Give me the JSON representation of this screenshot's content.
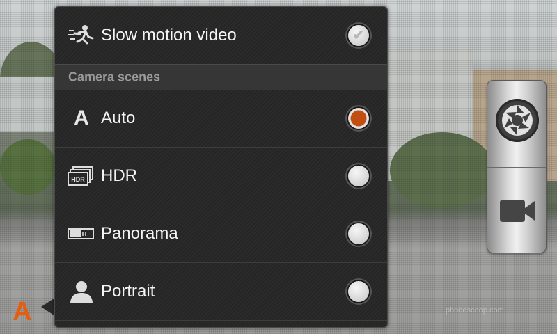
{
  "menu": {
    "slow_motion": {
      "label": "Slow motion video",
      "checked": true
    },
    "section_title": "Camera scenes",
    "scenes": [
      {
        "label": "Auto",
        "icon": "auto-scene-icon",
        "selected": true
      },
      {
        "label": "HDR",
        "icon": "hdr-icon",
        "selected": false
      },
      {
        "label": "Panorama",
        "icon": "panorama-icon",
        "selected": false
      },
      {
        "label": "Portrait",
        "icon": "portrait-icon",
        "selected": false
      }
    ]
  },
  "current_mode_indicator": "A",
  "watermark": "phonescoop.com",
  "colors": {
    "accent": "#e55d0f",
    "selected_radio": "#c24d10"
  }
}
